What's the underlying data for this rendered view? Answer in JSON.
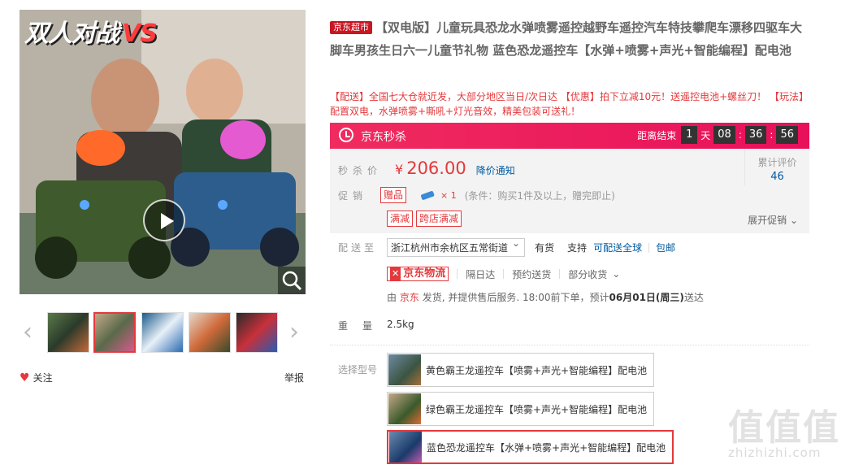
{
  "gallery": {
    "promo_text": "双人对战",
    "promo_vs": "VS",
    "thumb_count": 5,
    "active_thumb": 1,
    "follow_label": "关注",
    "report_label": "举报"
  },
  "product": {
    "store_tag": "京东超市",
    "title": "【双电版】儿童玩具恐龙水弹喷雾遥控越野车遥控汽车特技攀爬车漂移四驱车大脚车男孩生日六一儿童节礼物 蓝色恐龙遥控车【水弹+喷雾+声光+智能编程】配电池",
    "subtitle": "【配送】全国七大仓就近发，大部分地区当日/次日达 【优惠】拍下立减10元！送遥控电池+螺丝刀！ 【玩法】配置双电，水弹喷雾+嘶吼+灯光音效，精美包装可送礼！"
  },
  "seckill": {
    "title": "京东秒杀",
    "countdown_label": "距离结束",
    "days": "1",
    "day_unit": "天",
    "hours": "08",
    "minutes": "36",
    "seconds": "56"
  },
  "price": {
    "label": "秒杀价",
    "currency": "¥",
    "value": "206.00",
    "notify": "降价通知",
    "review_label": "累计评价",
    "review_count": "46"
  },
  "promotion": {
    "label": "促销",
    "gift_badge": "赠品",
    "gift_count": "× 1",
    "gift_condition": "(条件：购买1件及以上，赠完即止)",
    "tags": [
      "满减",
      "跨店满减"
    ],
    "expand": "展开促销"
  },
  "shipping": {
    "label": "配送至",
    "address": "浙江杭州市余杭区五常街道",
    "stock": "有货",
    "support": "支持",
    "global": "可配送全球",
    "free_ship": "包邮",
    "logistics": "京东物流",
    "services": [
      "隔日达",
      "预约送货",
      "部分收货"
    ],
    "note_prefix": "由",
    "seller": "京东",
    "note_mid": "发货, 并提供售后服务. 18:00前下单，预计",
    "eta": "06月01日(周三)",
    "note_suffix": "送达"
  },
  "weight": {
    "label": "重量",
    "value": "2.5kg"
  },
  "models": {
    "label": "选择型号",
    "options": [
      "黄色霸王龙遥控车【喷雾+声光+智能编程】配电池",
      "绿色霸王龙遥控车【喷雾+声光+智能编程】配电池",
      "蓝色恐龙遥控车【水弹+喷雾+声光+智能编程】配电池"
    ],
    "selected": 2
  },
  "watermark": {
    "chars": "值值值",
    "url": "zhizhizhi.com"
  }
}
